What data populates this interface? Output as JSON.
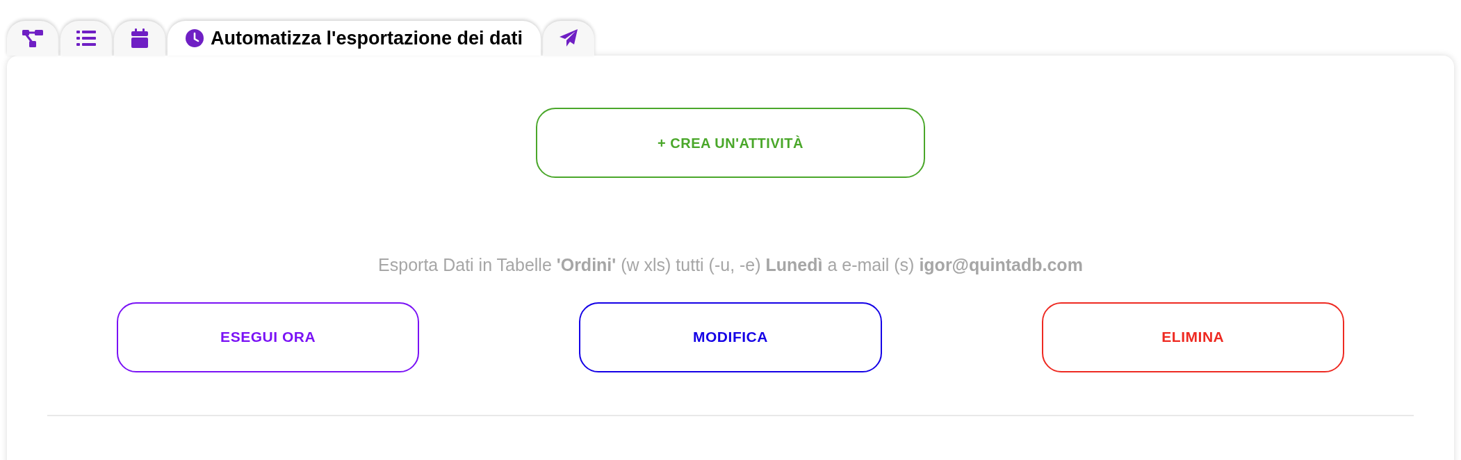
{
  "tabs": [
    {
      "kind": "diagram",
      "selected": false
    },
    {
      "kind": "list",
      "selected": false
    },
    {
      "kind": "calendar",
      "selected": false
    },
    {
      "kind": "clock",
      "label": "Automatizza l'esportazione dei dati",
      "selected": true
    },
    {
      "kind": "send",
      "selected": false
    }
  ],
  "create_button": {
    "label": "+ CREA UN'ATTIVITÀ",
    "color": "#4aa72a"
  },
  "task": {
    "description": "Esporta Dati in Tabelle **'Ordini'** (w xls) tutti (-u, -e) **Lunedì** a e-mail (s) **igor@quintadb.com**",
    "actions": [
      {
        "label": "ESEGUI ORA",
        "color": "#7a12f5"
      },
      {
        "label": "MODIFICA",
        "color": "#1400e6"
      },
      {
        "label": "ELIMINA",
        "color": "#ee2a22"
      }
    ]
  }
}
